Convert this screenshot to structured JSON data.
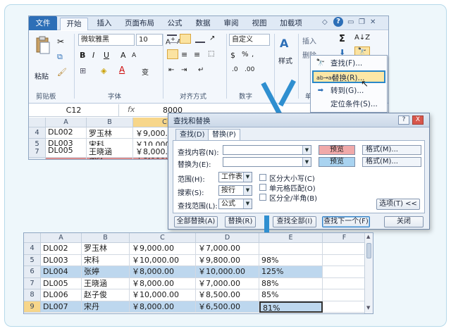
{
  "excel": {
    "menu": {
      "file": "文件",
      "tabs": [
        "开始",
        "插入",
        "页面布局",
        "公式",
        "数据",
        "审阅",
        "视图",
        "加载项"
      ]
    },
    "ribbon": {
      "clipboard": {
        "label": "剪贴板",
        "paste": "粘贴"
      },
      "font": {
        "label": "字体",
        "name": "微软雅黑",
        "size": "10"
      },
      "alignment": {
        "label": "对齐方式"
      },
      "number": {
        "label": "数字",
        "format": "自定义"
      },
      "styles": {
        "label": "样式"
      },
      "cells": {
        "insert": "插入",
        "delete": "删除",
        "label": "单"
      },
      "editing": {
        "sigma": "Σ"
      }
    },
    "formula_bar": {
      "name_box": "C12",
      "fx": "fx",
      "value": "8000"
    },
    "top_sheet": {
      "columns": [
        "A",
        "B",
        "C",
        "E"
      ],
      "rows": [
        {
          "num": "4",
          "a": "DL002",
          "b": "罗玉林",
          "c": "￥9,000.0"
        },
        {
          "num": "5",
          "a": "DL003",
          "b": "宋科",
          "c": "￥10,000"
        },
        {
          "num": "6",
          "a": "DL004",
          "b": "张婷",
          "c": "￥8,000.0"
        },
        {
          "num": "7",
          "a": "DL005",
          "b": "王晓涵",
          "c": "￥8,000.0"
        }
      ]
    },
    "find_menu": {
      "items": [
        "查找(F)...",
        "替换(R)...",
        "转到(G)...",
        "定位条件(S)..."
      ]
    }
  },
  "dialog": {
    "title": "查找和替换",
    "help": "?",
    "close": "X",
    "tabs": [
      "查找(D)",
      "替换(P)"
    ],
    "find_label": "查找内容(N):",
    "replace_label": "替换为(E):",
    "preview_label": "预览",
    "format_label": "格式(M)...",
    "scope_label": "范围(H):",
    "scope_value": "工作表",
    "search_label": "搜索(S):",
    "search_value": "按行",
    "lookin_label": "查找范围(L):",
    "lookin_value": "公式",
    "options": [
      "区分大小写(C)",
      "单元格匹配(O)",
      "区分全/半角(B)"
    ],
    "options_button": "选项(T) <<",
    "buttons": {
      "replace_all": "全部替换(A)",
      "replace": "替换(R)",
      "find_all": "查找全部(I)",
      "find_next": "查找下一个(F)",
      "close": "关闭"
    }
  },
  "bottom_sheet": {
    "columns": [
      "A",
      "B",
      "C",
      "D",
      "E",
      "F"
    ],
    "rows": [
      {
        "num": "4",
        "a": "DL002",
        "b": "罗玉林",
        "c": "￥9,000.00",
        "d": "￥7,000.00",
        "e": ""
      },
      {
        "num": "5",
        "a": "DL003",
        "b": "宋科",
        "c": "￥10,000.00",
        "d": "￥9,800.00",
        "e": "98%"
      },
      {
        "num": "6",
        "a": "DL004",
        "b": "张婷",
        "c": "￥8,000.00",
        "d": "￥10,000.00",
        "e": "125%"
      },
      {
        "num": "7",
        "a": "DL005",
        "b": "王晓涵",
        "c": "￥8,000.00",
        "d": "￥7,000.00",
        "e": "88%"
      },
      {
        "num": "8",
        "a": "DL006",
        "b": "赵子俊",
        "c": "￥10,000.00",
        "d": "￥8,500.00",
        "e": "85%"
      },
      {
        "num": "9",
        "a": "DL007",
        "b": "宋丹",
        "c": "￥8,000.00",
        "d": "￥6,500.00",
        "e": "81%"
      }
    ]
  },
  "colors": {
    "accent": "#2f8fd0",
    "file_tab": "#2d6fb7",
    "highlight_row": "#d98d8d",
    "preview_find": "#f0a9a9",
    "preview_replace": "#a9d3f0",
    "selected_row_bottom": "#bdd7ee"
  }
}
